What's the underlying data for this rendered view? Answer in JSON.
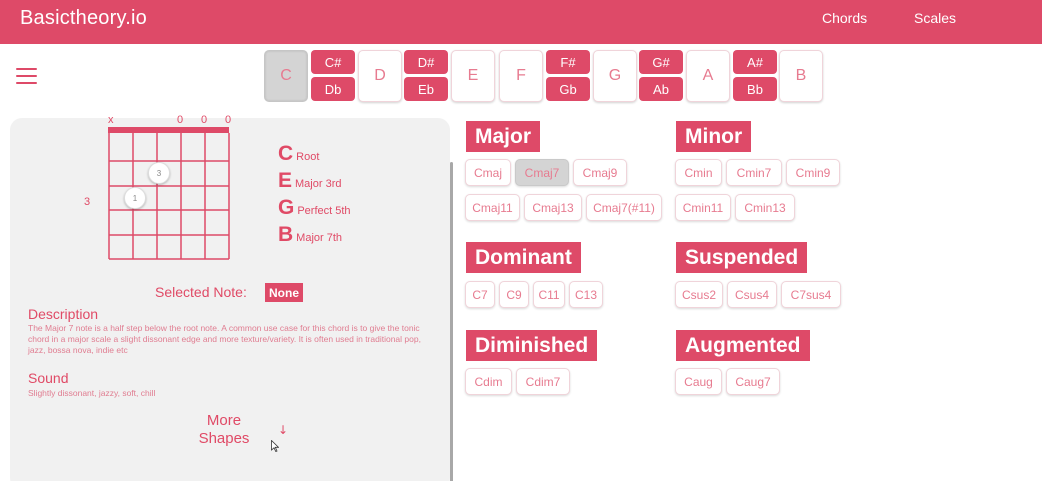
{
  "header": {
    "brand": "Basictheory.io",
    "nav": [
      "Chords",
      "Scales"
    ],
    "background": "#de4a68"
  },
  "menu_icon": "hamburger-icon",
  "root_notes": {
    "naturals": [
      "C",
      "D",
      "E",
      "F",
      "G",
      "A",
      "B"
    ],
    "accidentals": [
      {
        "sharp": "C#",
        "flat": "Db"
      },
      {
        "sharp": "D#",
        "flat": "Eb"
      },
      {
        "sharp": "F#",
        "flat": "Gb"
      },
      {
        "sharp": "G#",
        "flat": "Ab"
      },
      {
        "sharp": "A#",
        "flat": "Bb"
      }
    ],
    "selected": "C"
  },
  "diagram": {
    "string_marks": [
      "x",
      "0",
      "0",
      "0"
    ],
    "fret_number": "3",
    "dots": [
      "3",
      "1"
    ]
  },
  "chord_notes": [
    {
      "letter": "C",
      "label": "Root"
    },
    {
      "letter": "E",
      "label": "Major 3rd"
    },
    {
      "letter": "G",
      "label": "Perfect 5th"
    },
    {
      "letter": "B",
      "label": "Major 7th"
    }
  ],
  "selected_note": {
    "label": "Selected Note:",
    "value": "None"
  },
  "description": {
    "title": "Description",
    "text": "The Major 7 note is a half step below the root note. A common use case for this chord is to give the tonic chord in a major scale a slight dissonant edge and more texture/variety. It is often used in traditional pop, jazz, bossa nova, indie etc"
  },
  "sound": {
    "title": "Sound",
    "text": "Slightly dissonant, jazzy, soft, chill"
  },
  "more_shapes": {
    "line1": "More",
    "line2": "Shapes",
    "arrow": "↓"
  },
  "groups": {
    "major": {
      "title": "Major",
      "chords": [
        "Cmaj",
        "Cmaj7",
        "Cmaj9",
        "Cmaj11",
        "Cmaj13",
        "Cmaj7(#11)"
      ]
    },
    "minor": {
      "title": "Minor",
      "chords": [
        "Cmin",
        "Cmin7",
        "Cmin9",
        "Cmin11",
        "Cmin13"
      ]
    },
    "dominant": {
      "title": "Dominant",
      "chords": [
        "C7",
        "C9",
        "C11",
        "C13"
      ]
    },
    "suspended": {
      "title": "Suspended",
      "chords": [
        "Csus2",
        "Csus4",
        "C7sus4"
      ]
    },
    "diminished": {
      "title": "Diminished",
      "chords": [
        "Cdim",
        "Cdim7"
      ]
    },
    "augmented": {
      "title": "Augmented",
      "chords": [
        "Caug",
        "Caug7"
      ]
    },
    "selected": "Cmaj7"
  },
  "colors": {
    "accent": "#de4a68",
    "selected_bg": "#d4d4d4",
    "panel_bg": "#f1f1f1"
  }
}
